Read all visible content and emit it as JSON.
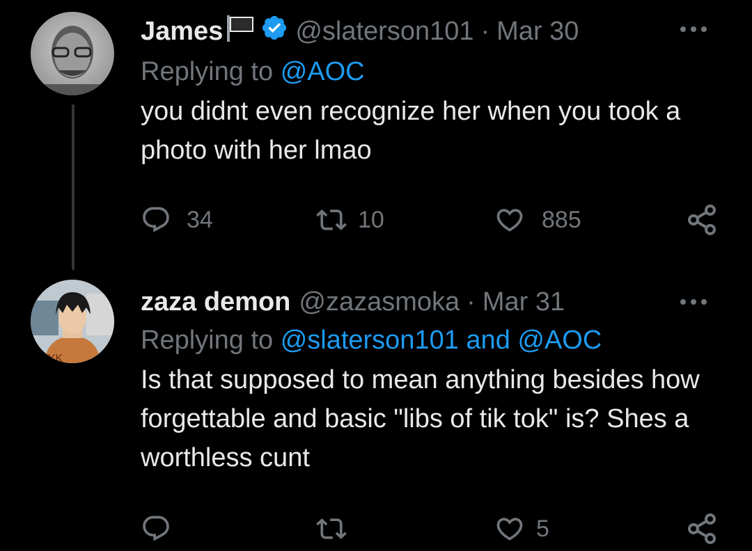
{
  "tweets": [
    {
      "name": "James",
      "handle": "@slaterson101",
      "separator": "·",
      "date": "Mar 30",
      "replying_prefix": "Replying to",
      "replying_to": [
        "@AOC"
      ],
      "replying_joiner": "",
      "text": "you didnt even recognize her when you took a photo with her lmao",
      "replies": "34",
      "retweets": "10",
      "likes": "885",
      "verified": true,
      "has_flag": true
    },
    {
      "name": "zaza demon",
      "handle": "@zazasmoka",
      "separator": "·",
      "date": "Mar 31",
      "replying_prefix": "Replying to",
      "replying_to": [
        "@slaterson101",
        "@AOC"
      ],
      "replying_joiner": "and",
      "text": "Is that supposed to mean anything besides how forgettable and basic \"libs of tik tok\" is? Shes a worthless cunt",
      "replies": "",
      "retweets": "",
      "likes": "5",
      "verified": false,
      "has_flag": false
    }
  ],
  "icons": {
    "reply": "reply-icon",
    "retweet": "retweet-icon",
    "like": "heart-icon",
    "share": "share-icon",
    "more": "more-icon",
    "verified": "verified-badge-icon",
    "flag": "flag-icon"
  },
  "colors": {
    "background": "#000000",
    "text": "#e7e9ea",
    "muted": "#71767b",
    "link": "#1d9bf0"
  }
}
